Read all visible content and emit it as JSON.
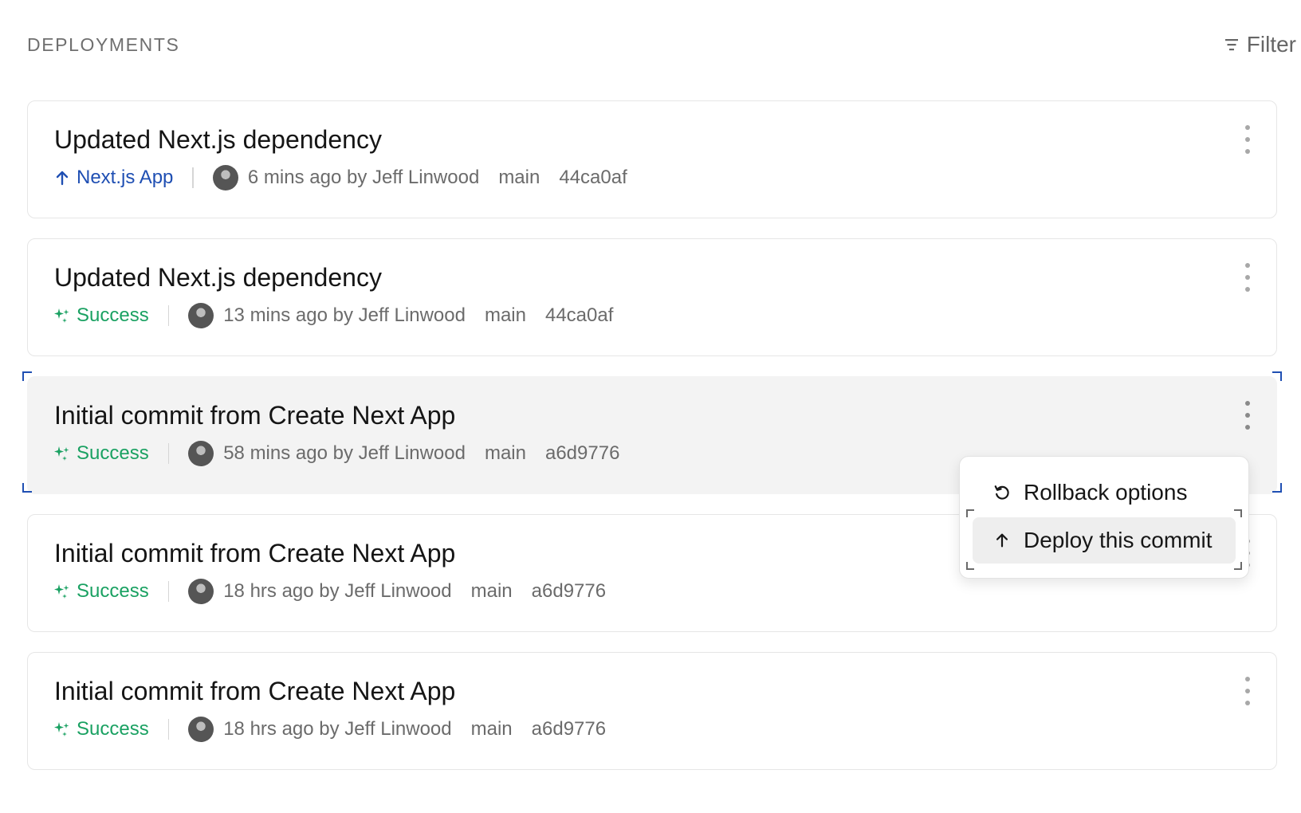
{
  "header": {
    "title": "DEPLOYMENTS",
    "filter_label": "Filter"
  },
  "deployments": [
    {
      "title": "Updated Next.js dependency",
      "status": "Next.js App",
      "status_type": "deploying",
      "time_author": "6 mins ago by Jeff Linwood",
      "branch": "main",
      "commit": "44ca0af"
    },
    {
      "title": "Updated Next.js dependency",
      "status": "Success",
      "status_type": "success",
      "time_author": "13 mins ago by Jeff Linwood",
      "branch": "main",
      "commit": "44ca0af"
    },
    {
      "title": "Initial commit from Create Next App",
      "status": "Success",
      "status_type": "success",
      "time_author": "58 mins ago by Jeff Linwood",
      "branch": "main",
      "commit": "a6d9776"
    },
    {
      "title": "Initial commit from Create Next App",
      "status": "Success",
      "status_type": "success",
      "time_author": "18 hrs ago by Jeff Linwood",
      "branch": "main",
      "commit": "a6d9776"
    },
    {
      "title": "Initial commit from Create Next App",
      "status": "Success",
      "status_type": "success",
      "time_author": "18 hrs ago by Jeff Linwood",
      "branch": "main",
      "commit": "a6d9776"
    }
  ],
  "context_menu": {
    "items": [
      {
        "label": "Rollback options",
        "icon": "rollback-icon"
      },
      {
        "label": "Deploy this commit",
        "icon": "arrow-up-icon"
      }
    ]
  },
  "colors": {
    "deploying": "#1f4fb3",
    "success": "#1aa162",
    "focus": "#1f4fb3",
    "hover_bg": "#f3f3f3"
  }
}
